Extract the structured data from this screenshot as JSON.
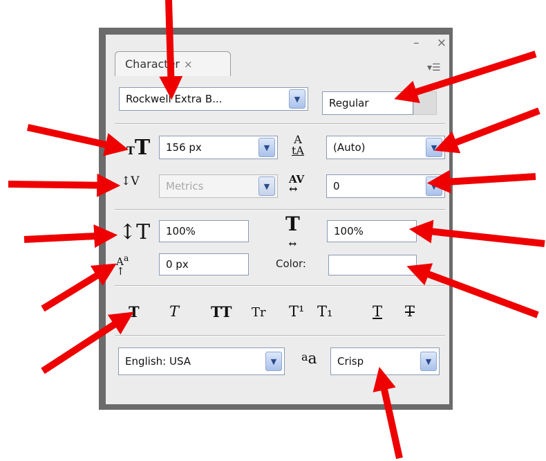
{
  "panel": {
    "tab_label": "Character",
    "tab_close": "×",
    "window_buttons": "– ×",
    "menu_icon": "▾☰"
  },
  "font": {
    "family": "Rockwell Extra B...",
    "style": "Regular"
  },
  "metrics": {
    "size": "156 px",
    "leading": "(Auto)",
    "kerning": "Metrics",
    "tracking": "0",
    "vertical_scale": "100%",
    "horizontal_scale": "100%",
    "baseline_shift": "0 px",
    "color_label": "Color:"
  },
  "style_buttons": [
    "T",
    "T",
    "TT",
    "Tr",
    "T¹",
    "T₁",
    "T",
    "T"
  ],
  "language": "English: USA",
  "antialias_label": "aa",
  "antialias": "Crisp",
  "dropdown_glyph": "▼",
  "colors": {
    "arrow": "#ee0000",
    "frame": "#6b6b6b",
    "panel": "#ececec"
  }
}
